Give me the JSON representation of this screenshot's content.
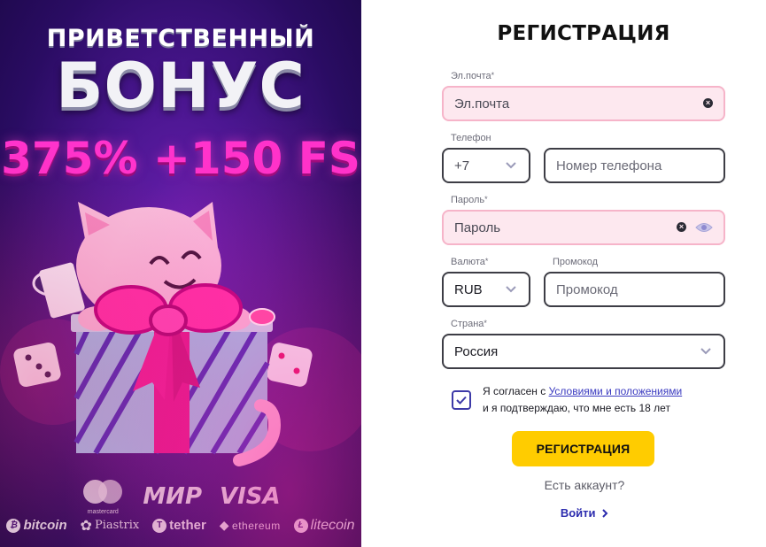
{
  "promo": {
    "title_line1": "ПРИВЕТСТВЕННЫЙ",
    "title_line2": "БОНУС",
    "bonus": "375% +150 FS",
    "payments": {
      "mastercard": "mastercard",
      "mir": "МИР",
      "visa": "VISA"
    },
    "crypto": {
      "bitcoin": "bitcoin",
      "piastrix": "Piastrix",
      "tether": "tether",
      "ethereum": "ethereum",
      "litecoin": "litecoin"
    }
  },
  "form": {
    "title": "РЕГИСТРАЦИЯ",
    "email": {
      "label": "Эл.почта",
      "placeholder": "Эл.почта"
    },
    "phone": {
      "label": "Телефон",
      "code": "+7",
      "placeholder": "Номер телефона"
    },
    "password": {
      "label": "Пароль",
      "placeholder": "Пароль"
    },
    "currency": {
      "label": "Валюта",
      "value": "RUB"
    },
    "promo": {
      "label": "Промокод",
      "placeholder": "Промокод"
    },
    "country": {
      "label": "Страна",
      "value": "Россия"
    },
    "required_mark": "*",
    "consent": {
      "checked": true,
      "prefix": "Я согласен с ",
      "link": "Условиями и положениями",
      "suffix": "и я подтверждаю, что мне есть 18 лет"
    },
    "submit_label": "РЕГИСТРАЦИЯ",
    "has_account": "Есть аккаунт?",
    "login_label": "Войти"
  },
  "colors": {
    "accent": "#ffcc00",
    "link": "#3a3ac0",
    "error_bg": "#fde8ef",
    "promo_pink": "#ff33cc"
  }
}
